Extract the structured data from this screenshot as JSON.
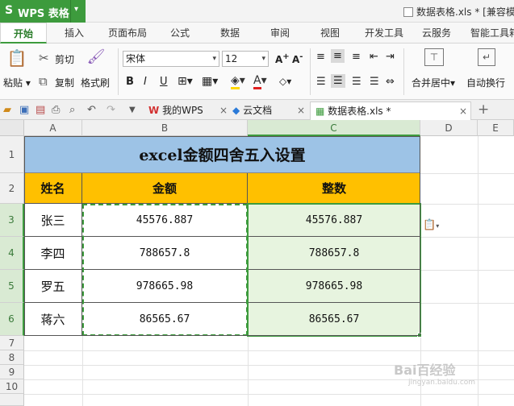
{
  "app": {
    "name": "WPS 表格",
    "logo": "S",
    "doc_title": "数据表格.xls * [兼容模式]"
  },
  "tabs": [
    "开始",
    "插入",
    "页面布局",
    "公式",
    "数据",
    "审阅",
    "视图",
    "开发工具",
    "云服务",
    "智能工具箱"
  ],
  "ribbon": {
    "paste": "粘贴",
    "cut": "剪切",
    "copy": "复制",
    "format_painter": "格式刷",
    "font_name": "宋体",
    "font_size": "12",
    "merge_center": "合并居中",
    "wrap_text": "自动换行",
    "icons": [
      "paste-icon",
      "scissors-icon",
      "copy-icon",
      "brush-icon",
      "bold-icon",
      "italic-icon",
      "underline-icon",
      "border-icon",
      "fill-color-icon",
      "font-color-icon",
      "align-icon",
      "merge-icon",
      "wrap-icon"
    ]
  },
  "doc_tabs": [
    {
      "label": "我的WPS",
      "icon": "wps-icon"
    },
    {
      "label": "云文档",
      "icon": "cloud-doc-icon"
    },
    {
      "label": "数据表格.xls *",
      "icon": "sheet-icon"
    }
  ],
  "add_tab": "+",
  "columns": [
    "A",
    "B",
    "C",
    "D",
    "E"
  ],
  "rows": [
    "1",
    "2",
    "3",
    "4",
    "5",
    "6",
    "7",
    "8",
    "9",
    "10"
  ],
  "sheet": {
    "title": "excel金额四舍五入设置",
    "headers": [
      "姓名",
      "金额",
      "整数"
    ],
    "data": [
      [
        "张三",
        "45576.887",
        "45576.887"
      ],
      [
        "李四",
        "788657.8",
        "788657.8"
      ],
      [
        "罗五",
        "978665.98",
        "978665.98"
      ],
      [
        "蒋六",
        "86565.67",
        "86565.67"
      ]
    ]
  },
  "colors": {
    "accent": "#3d9b3d",
    "title_fill": "#9dc3e6",
    "header_fill": "#ffc000",
    "selection_fill": "#e7f4df"
  },
  "watermark": {
    "text": "Bai百经验",
    "url": "jingyan.baidu.com"
  }
}
